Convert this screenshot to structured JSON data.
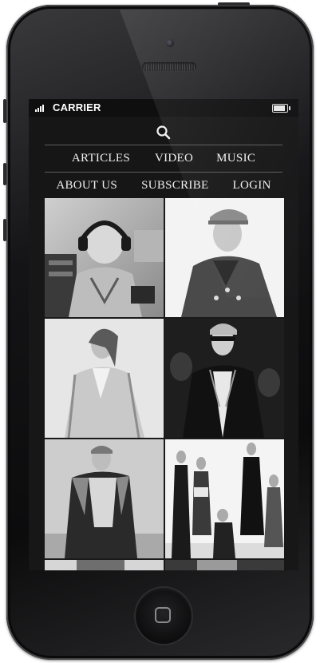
{
  "status_bar": {
    "carrier": "CARRIER",
    "signal_bars": 4,
    "battery_level": 0.85
  },
  "header": {
    "search_icon": "search-icon",
    "nav_row1": [
      {
        "label": "ARTICLES"
      },
      {
        "label": "VIDEO"
      },
      {
        "label": "MUSIC"
      }
    ],
    "nav_row2": [
      {
        "label": "ABOUT US"
      },
      {
        "label": "SUBSCRIBE"
      },
      {
        "label": "LOGIN"
      }
    ]
  },
  "gallery": {
    "tiles": [
      {
        "image": "photo-dj-headphones"
      },
      {
        "image": "photo-man-cap-coat"
      },
      {
        "image": "photo-woman-trench"
      },
      {
        "image": "photo-man-sunglasses-blazer"
      },
      {
        "image": "photo-runway-man-coat"
      },
      {
        "image": "photo-group-models"
      },
      {
        "image": "photo-partial-left"
      },
      {
        "image": "photo-partial-right"
      }
    ]
  },
  "colors": {
    "phone_body": "#141416",
    "screen_bg": "#171718",
    "nav_text": "#f0f0f0",
    "divider": "#5c5c5e"
  }
}
